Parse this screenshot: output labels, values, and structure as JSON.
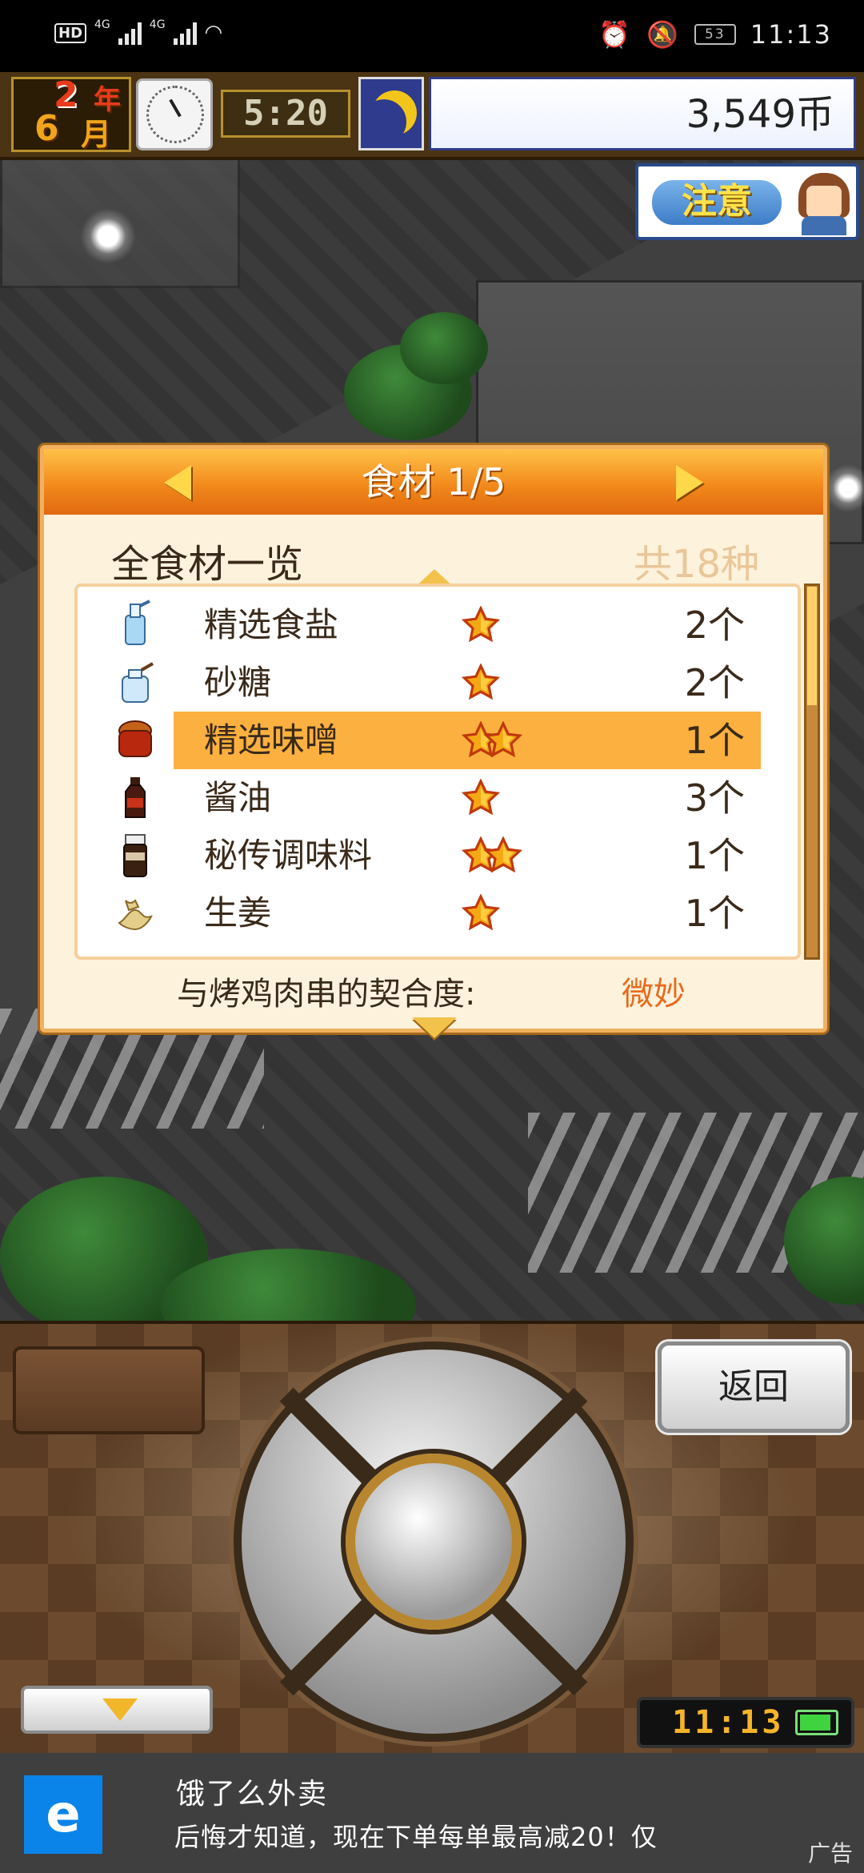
{
  "status_bar": {
    "left_badges": [
      "HD",
      "4G",
      "4G"
    ],
    "battery": "53",
    "time": "11:13"
  },
  "hud": {
    "year_num": "2",
    "year_unit": "年",
    "month_num": "6",
    "month_unit": "月",
    "game_time": "5:20",
    "money": "3,549币"
  },
  "notice_button": {
    "label": "注意"
  },
  "panel": {
    "title": "食材 1/5",
    "subtitle": "全食材一览",
    "total": "共18种",
    "items": [
      {
        "name": "精选食盐",
        "stars": 1,
        "count": "2个",
        "icon": "salt-bottle-icon",
        "selected": false
      },
      {
        "name": "砂糖",
        "stars": 1,
        "count": "2个",
        "icon": "sugar-jar-icon",
        "selected": false
      },
      {
        "name": "精选味噌",
        "stars": 2,
        "count": "1个",
        "icon": "miso-pot-icon",
        "selected": true
      },
      {
        "name": "酱油",
        "stars": 1,
        "count": "3个",
        "icon": "soy-sauce-icon",
        "selected": false
      },
      {
        "name": "秘传调味料",
        "stars": 2,
        "count": "1个",
        "icon": "secret-seasoning-icon",
        "selected": false
      },
      {
        "name": "生姜",
        "stars": 1,
        "count": "1个",
        "icon": "ginger-icon",
        "selected": false
      }
    ],
    "compat_label": "与烤鸡肉串的契合度:",
    "compat_value": "微妙",
    "colors": {
      "header": "#f28a1c",
      "highlight": "#fbb040",
      "compat_value": "#e86a1c"
    }
  },
  "controller": {
    "back_label": "返回",
    "clock": "11:13"
  },
  "ad": {
    "title": "饿了么外卖",
    "text": "后悔才知道，现在下单每单最高减20！仅",
    "tag": "广告"
  }
}
